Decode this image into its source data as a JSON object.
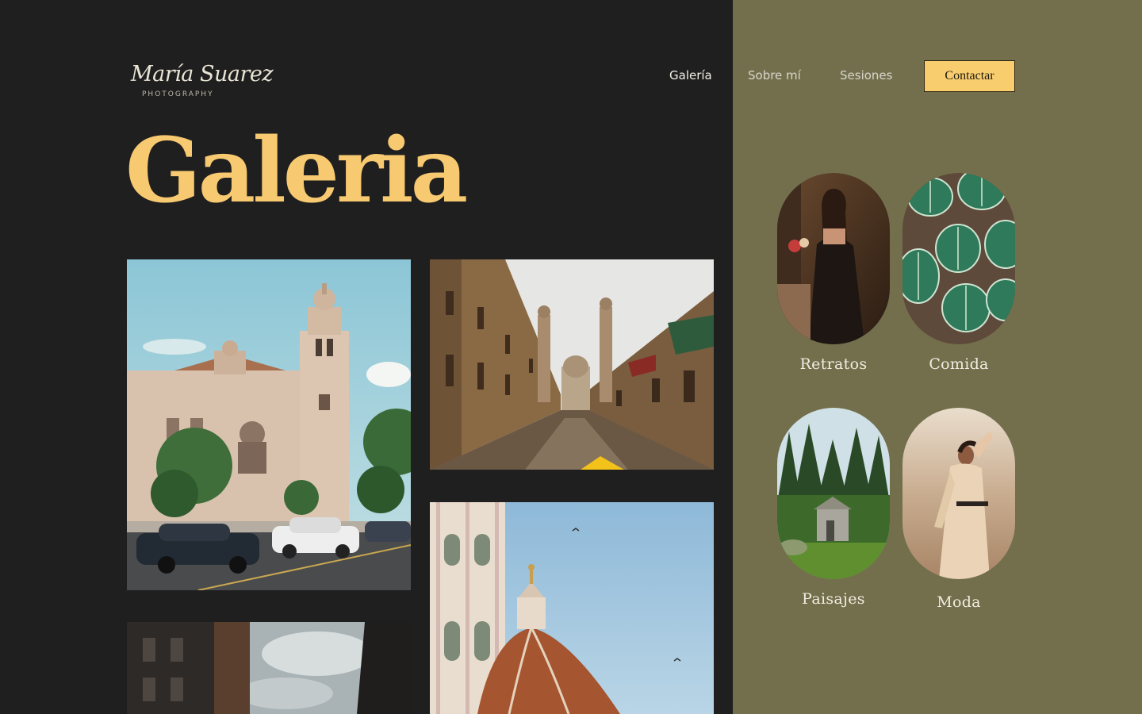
{
  "brand": {
    "name": "María Suarez",
    "tagline": "PHOTOGRAPHY"
  },
  "nav": {
    "links": [
      {
        "label": "Galería",
        "active": true
      },
      {
        "label": "Sobre mí",
        "active": false
      },
      {
        "label": "Sesiones",
        "active": false
      }
    ],
    "cta_label": "Contactar"
  },
  "page": {
    "title": "Galeria"
  },
  "gallery": {
    "photos": [
      {
        "subject": "church-tower-street"
      },
      {
        "subject": "colonial-street-cathedral"
      },
      {
        "subject": "florence-dome"
      },
      {
        "subject": "city-buildings-sky"
      }
    ]
  },
  "categories": [
    {
      "label": "Retratos",
      "subject": "portrait-woman"
    },
    {
      "label": "Comida",
      "subject": "watermelon-peperomia-plant"
    },
    {
      "label": "Paisajes",
      "subject": "forest-stone-hut"
    },
    {
      "label": "Moda",
      "subject": "fashion-woman-desert"
    }
  ],
  "colors": {
    "background": "#1f1f1f",
    "panel": "#736f4d",
    "accent": "#f7c970",
    "button": "#f8cd6e"
  }
}
